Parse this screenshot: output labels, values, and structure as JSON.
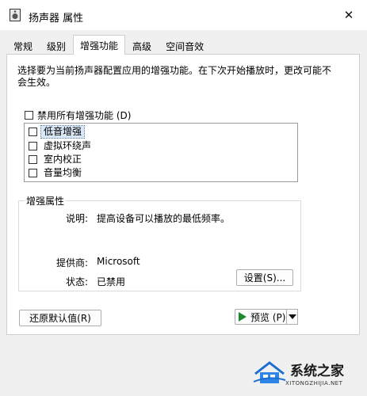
{
  "window": {
    "title": "扬声器 属性",
    "icon": "speaker-icon",
    "close_glyph": "✕"
  },
  "tabs": [
    {
      "label": "常规",
      "active": false
    },
    {
      "label": "级别",
      "active": false
    },
    {
      "label": "增强功能",
      "active": true
    },
    {
      "label": "高级",
      "active": false
    },
    {
      "label": "空间音效",
      "active": false
    }
  ],
  "enhancements": {
    "description": "选择要为当前扬声器配置应用的增强功能。在下次开始播放时，更改可能不会生效。",
    "disable_all_label": "禁用所有增强功能 (D)",
    "items": [
      {
        "label": "低音增强",
        "checked": false,
        "selected": true
      },
      {
        "label": "虚拟环绕声",
        "checked": false,
        "selected": false
      },
      {
        "label": "室内校正",
        "checked": false,
        "selected": false
      },
      {
        "label": "音量均衡",
        "checked": false,
        "selected": false
      }
    ]
  },
  "properties": {
    "group_title": "增强属性",
    "description_label": "说明:",
    "description_value": "提高设备可以播放的最低频率。",
    "provider_label": "提供商:",
    "provider_value": "Microsoft",
    "status_label": "状态:",
    "status_value": "已禁用",
    "settings_button": "设置(S)..."
  },
  "footer": {
    "restore_defaults_button": "还原默认值(R)",
    "preview_button": "预览 (P)"
  },
  "watermark": {
    "text": "系统之家",
    "subtext": "XITONGZHIJIA.NET"
  },
  "colors": {
    "play_icon": "#1e8a2e",
    "selection": "#dbe8f7"
  }
}
